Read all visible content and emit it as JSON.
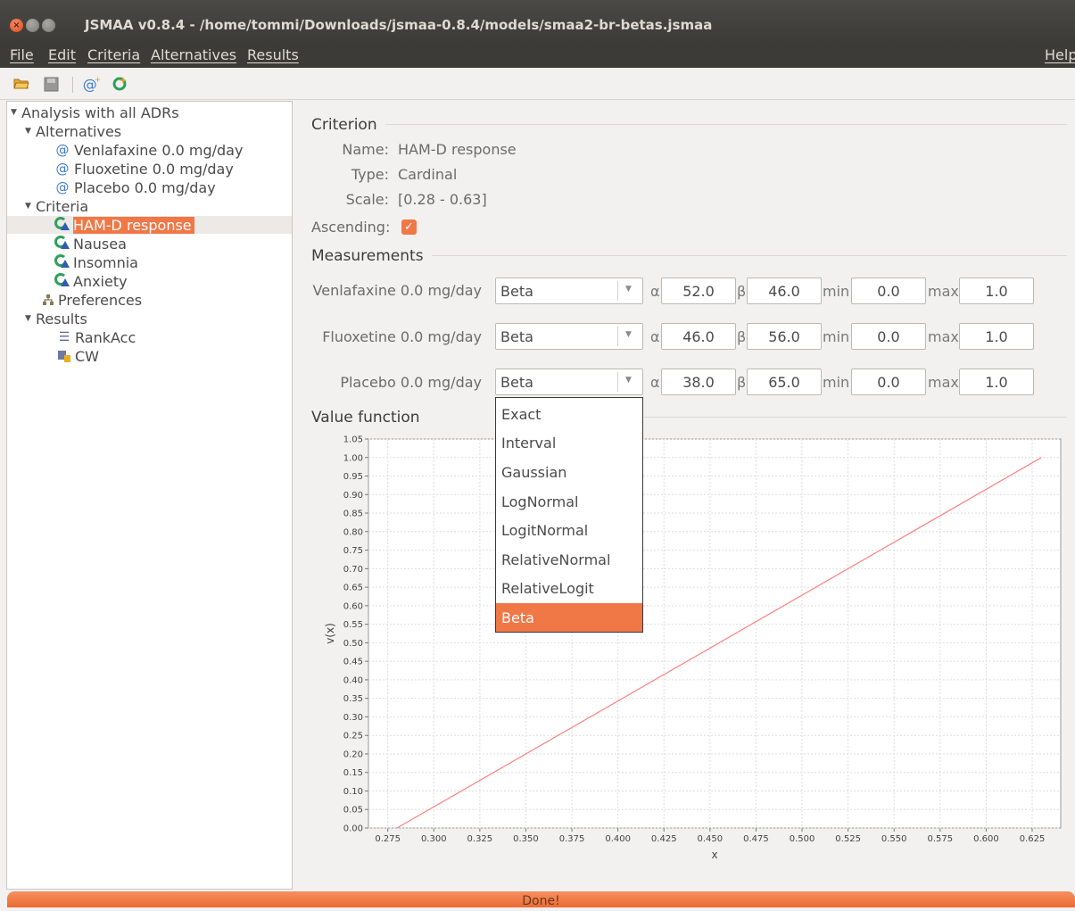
{
  "window": {
    "title": "JSMAA v0.8.4 - /home/tommi/Downloads/jsmaa-0.8.4/models/smaa2-br-betas.jsmaa"
  },
  "menu": {
    "file": "File",
    "edit": "Edit",
    "criteria": "Criteria",
    "alternatives": "Alternatives",
    "results": "Results",
    "help": "Help"
  },
  "toolbar": {
    "icons": [
      "folder-open-icon",
      "save-icon",
      "add-alternative-icon",
      "add-criterion-icon"
    ]
  },
  "tree": {
    "root": "Analysis with all ADRs",
    "alternatives_label": "Alternatives",
    "alternatives": [
      "Venlafaxine 0.0 mg/day",
      "Fluoxetine 0.0 mg/day",
      "Placebo 0.0 mg/day"
    ],
    "criteria_label": "Criteria",
    "criteria": [
      "HAM-D response",
      "Nausea",
      "Insomnia",
      "Anxiety"
    ],
    "selected": "HAM-D response",
    "preferences": "Preferences",
    "results_label": "Results",
    "results": [
      "RankAcc",
      "CW"
    ]
  },
  "criterion": {
    "section_title": "Criterion",
    "name_label": "Name:",
    "name": "HAM-D response",
    "type_label": "Type:",
    "type": "Cardinal",
    "scale_label": "Scale:",
    "scale": "[0.28 - 0.63]",
    "ascending_label": "Ascending:",
    "ascending": true
  },
  "measurements": {
    "section_title": "Measurements",
    "alpha_symbol": "α",
    "beta_symbol": "β",
    "min_label": "min",
    "max_label": "max",
    "rows": [
      {
        "alternative": "Venlafaxine 0.0 mg/day",
        "distribution": "Beta",
        "alpha": "52.0",
        "beta": "46.0",
        "min": "0.0",
        "max": "1.0"
      },
      {
        "alternative": "Fluoxetine 0.0 mg/day",
        "distribution": "Beta",
        "alpha": "46.0",
        "beta": "56.0",
        "min": "0.0",
        "max": "1.0"
      },
      {
        "alternative": "Placebo 0.0 mg/day",
        "distribution": "Beta",
        "alpha": "38.0",
        "beta": "65.0",
        "min": "0.0",
        "max": "1.0"
      }
    ]
  },
  "dropdown": {
    "options": [
      "Exact",
      "Interval",
      "Gaussian",
      "LogNormal",
      "LogitNormal",
      "RelativeNormal",
      "RelativeLogit",
      "Beta"
    ],
    "selected": "Beta"
  },
  "value_function": {
    "section_title": "Value function"
  },
  "chart_data": {
    "type": "line",
    "title": "",
    "xlabel": "x",
    "ylabel": "v(x)",
    "xlim": [
      0.2645,
      0.6405
    ],
    "ylim": [
      0.0,
      1.05
    ],
    "x_ticks": [
      "0.275",
      "0.300",
      "0.325",
      "0.350",
      "0.375",
      "0.400",
      "0.425",
      "0.450",
      "0.475",
      "0.500",
      "0.525",
      "0.550",
      "0.575",
      "0.600",
      "0.625"
    ],
    "y_ticks": [
      "0.00",
      "0.05",
      "0.10",
      "0.15",
      "0.20",
      "0.25",
      "0.30",
      "0.35",
      "0.40",
      "0.45",
      "0.50",
      "0.55",
      "0.60",
      "0.65",
      "0.70",
      "0.75",
      "0.80",
      "0.85",
      "0.90",
      "0.95",
      "1.00",
      "1.05"
    ],
    "grid": true,
    "series": [
      {
        "x": [
          0.28,
          0.63
        ],
        "y": [
          0.0,
          1.0
        ],
        "color": "#ff8080"
      }
    ]
  },
  "status": {
    "text": "Done!"
  },
  "colors": {
    "accent": "#f07746",
    "titlebar": "#3c3b37"
  }
}
